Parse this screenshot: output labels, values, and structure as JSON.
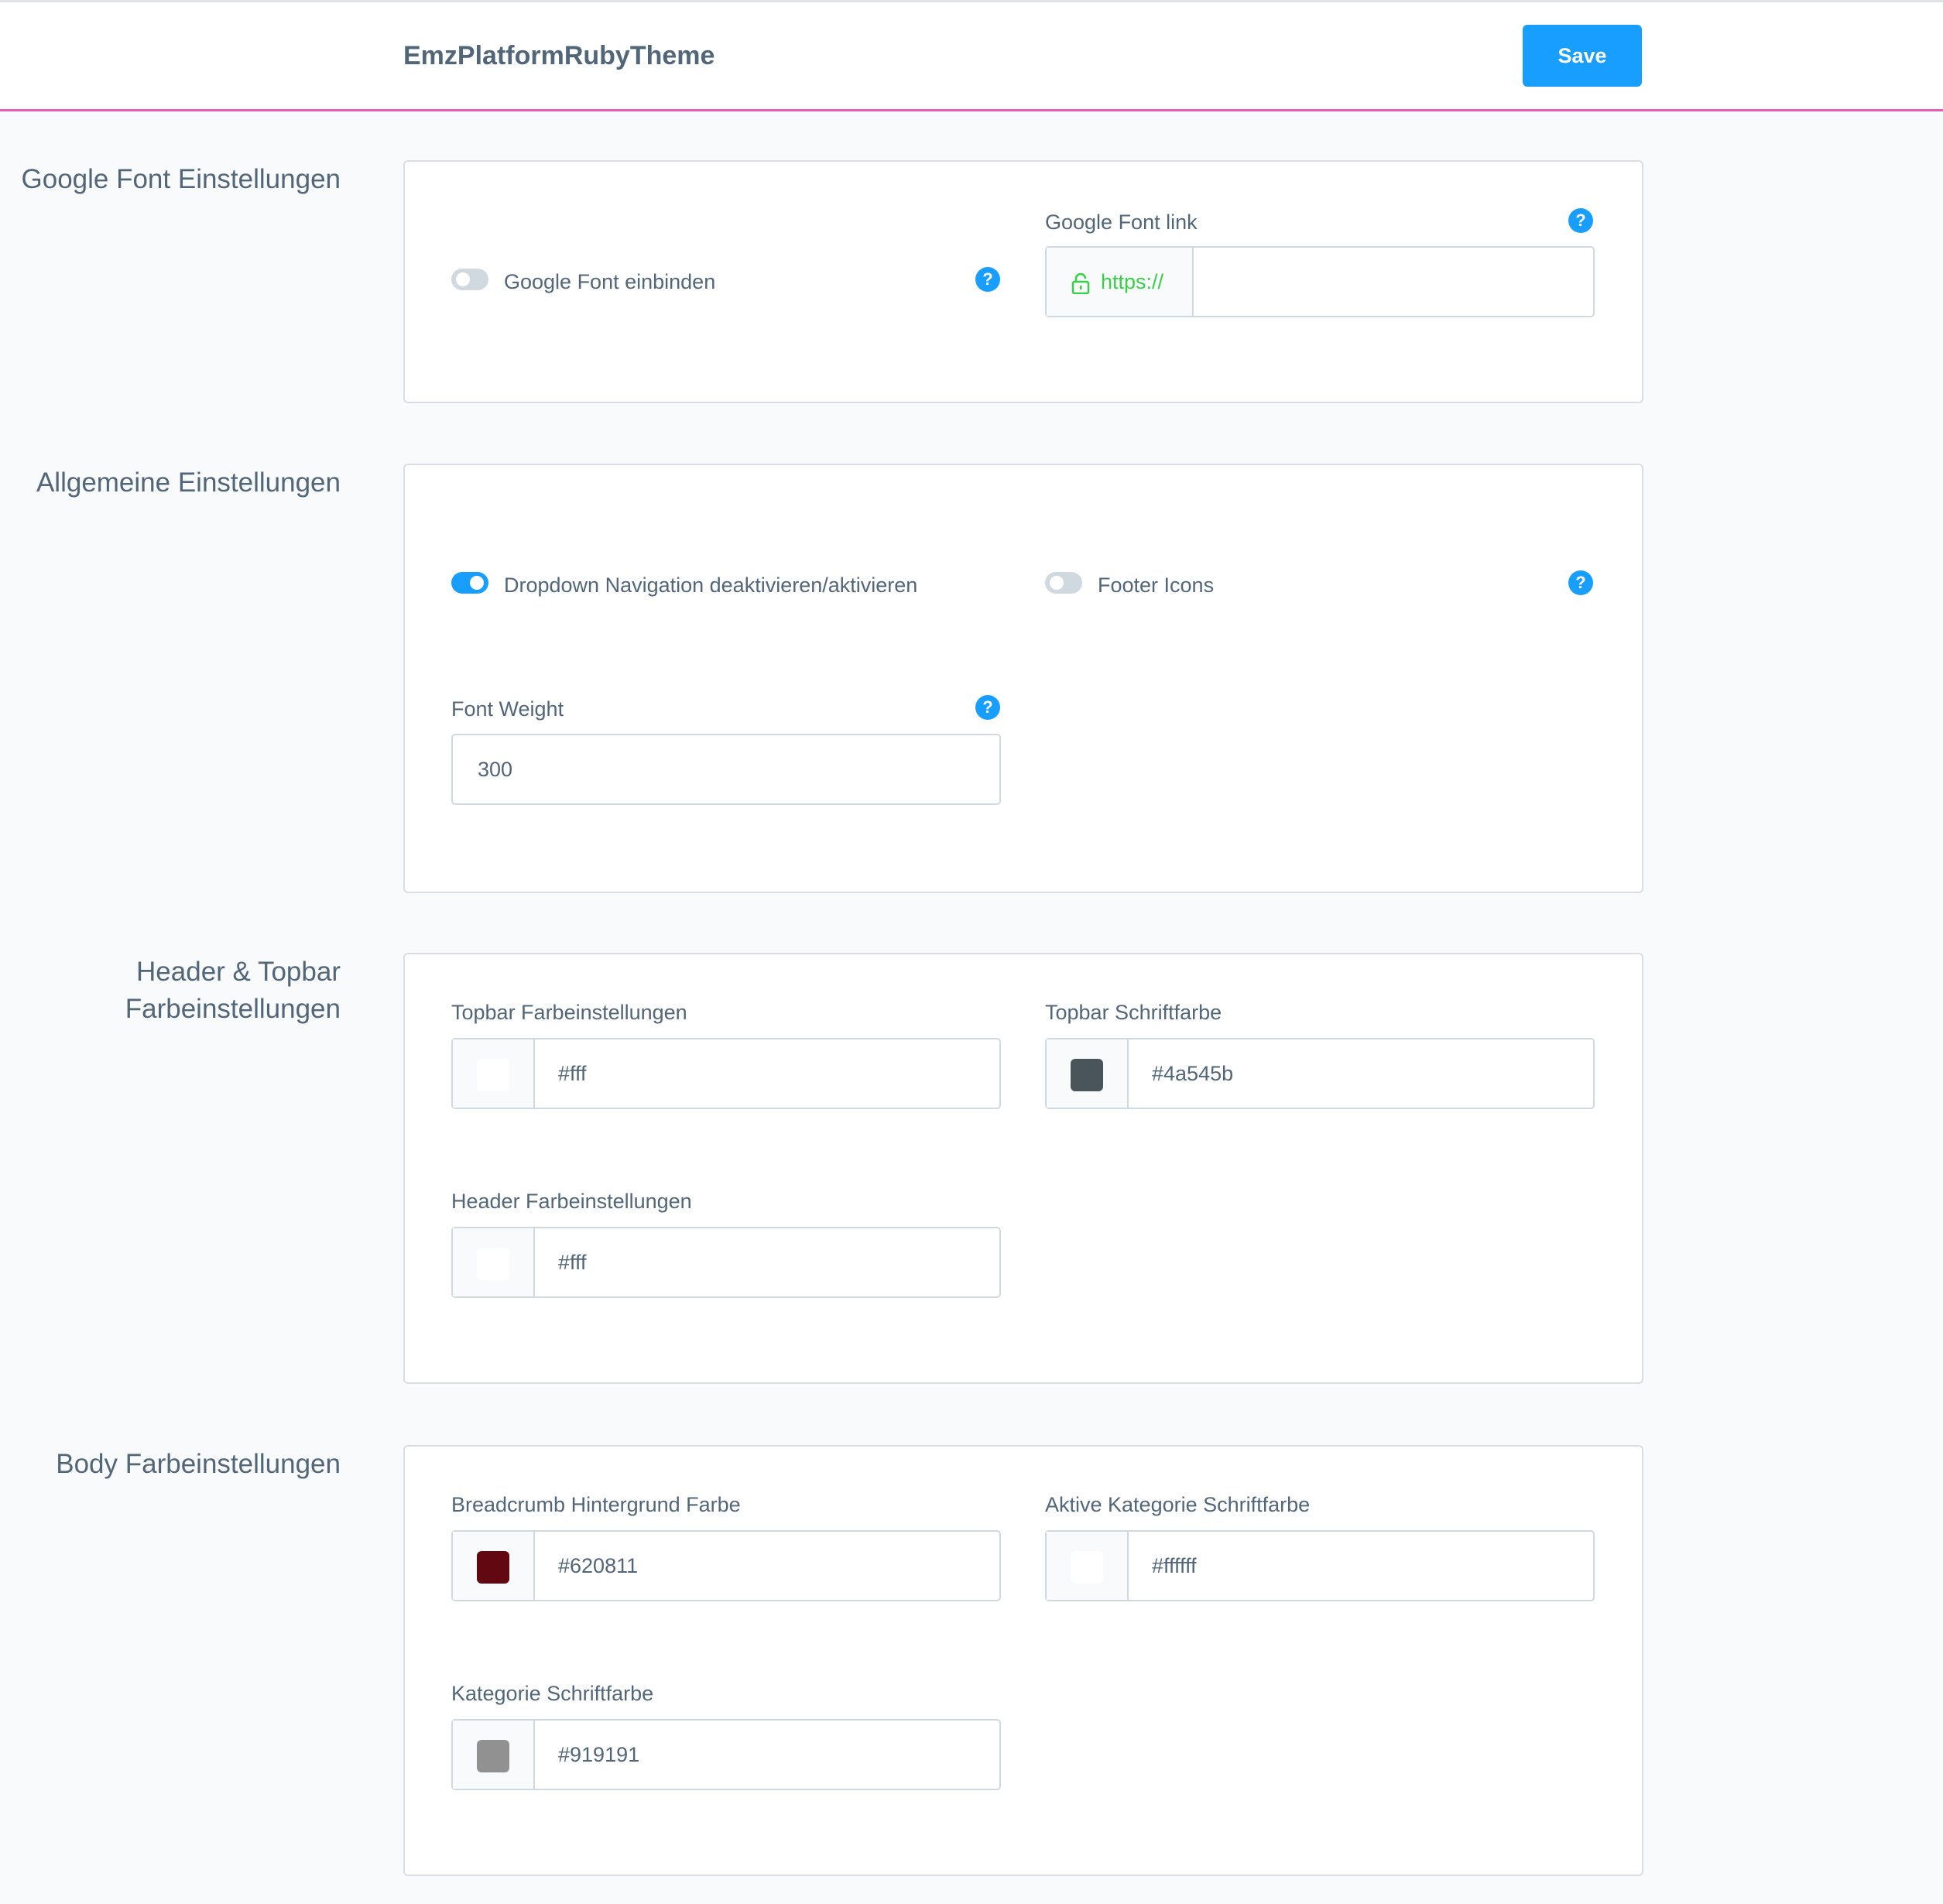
{
  "header": {
    "title": "EmzPlatformRubyTheme",
    "save_label": "Save"
  },
  "help_glyph": "?",
  "colors": {
    "accent": "#189eff",
    "header_border": "#e75cb4",
    "https_green": "#37d046"
  },
  "sections": {
    "google_font": {
      "label": "Google Font Einstellungen",
      "toggle_label": "Google Font einbinden",
      "toggle_on": false,
      "link_label": "Google Font link",
      "link_prefix": "https://",
      "link_value": ""
    },
    "general": {
      "label": "Allgemeine Einstellungen",
      "dropdown_label": "Dropdown Navigation deaktivieren/aktivieren",
      "dropdown_on": true,
      "footer_icons_label": "Footer Icons",
      "footer_icons_on": false,
      "font_weight_label": "Font Weight",
      "font_weight_value": "300"
    },
    "header_topbar": {
      "label_line1": "Header & Topbar",
      "label_line2": "Farbeinstellungen",
      "topbar_color_label": "Topbar Farbeinstellungen",
      "topbar_color_value": "#fff",
      "topbar_font_label": "Topbar Schriftfarbe",
      "topbar_font_value": "#4a545b",
      "header_color_label": "Header Farbeinstellungen",
      "header_color_value": "#fff"
    },
    "body": {
      "label": "Body Farbeinstellungen",
      "breadcrumb_label": "Breadcrumb Hintergrund Farbe",
      "breadcrumb_value": "#620811",
      "active_cat_label": "Aktive Kategorie Schriftfarbe",
      "active_cat_value": "#ffffff",
      "cat_font_label": "Kategorie Schriftfarbe",
      "cat_font_value": "#919191"
    }
  }
}
